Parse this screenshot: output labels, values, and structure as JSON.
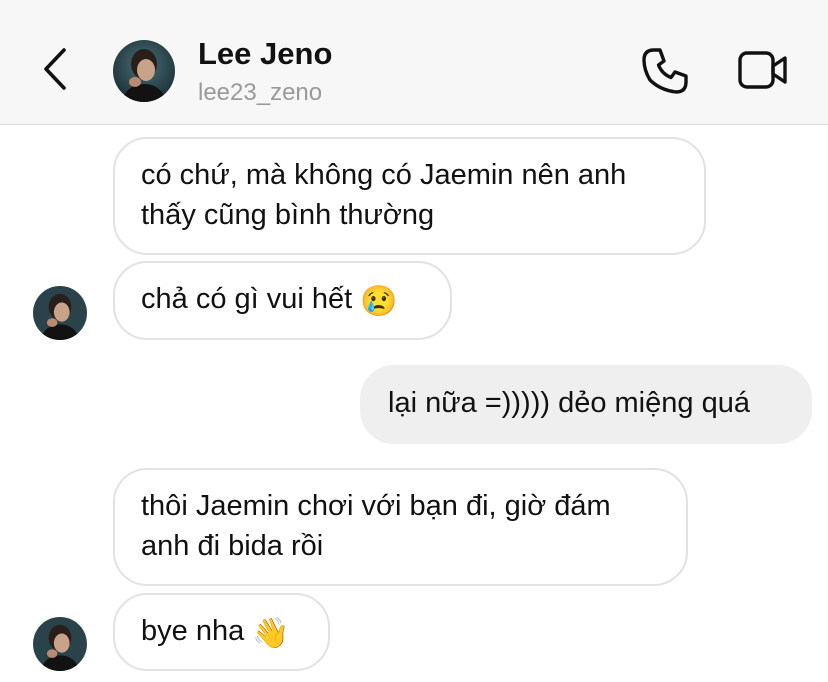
{
  "header": {
    "name": "Lee Jeno",
    "username": "lee23_zeno"
  },
  "messages": [
    {
      "side": "in",
      "text": "có chứ, mà không có Jaemin nên anh\nthấy cũng bình thường",
      "emoji": ""
    },
    {
      "side": "in",
      "text": "chả có gì vui hết",
      "emoji": "😢"
    },
    {
      "side": "out",
      "text": "lại nữa =))))) dẻo miệng quá",
      "emoji": ""
    },
    {
      "side": "in",
      "text": "thôi Jaemin chơi với bạn đi, giờ đám\nanh đi bida rồi",
      "emoji": ""
    },
    {
      "side": "in",
      "text": "bye nha",
      "emoji": "👋"
    }
  ],
  "icons": {
    "back": "chevron-left-icon",
    "call": "phone-icon",
    "video": "video-camera-icon"
  },
  "colors": {
    "header_bg": "#f7f7f7",
    "username": "#9a9a9a",
    "incoming_border": "#e2e2e2",
    "outgoing_bg": "#efefef"
  }
}
